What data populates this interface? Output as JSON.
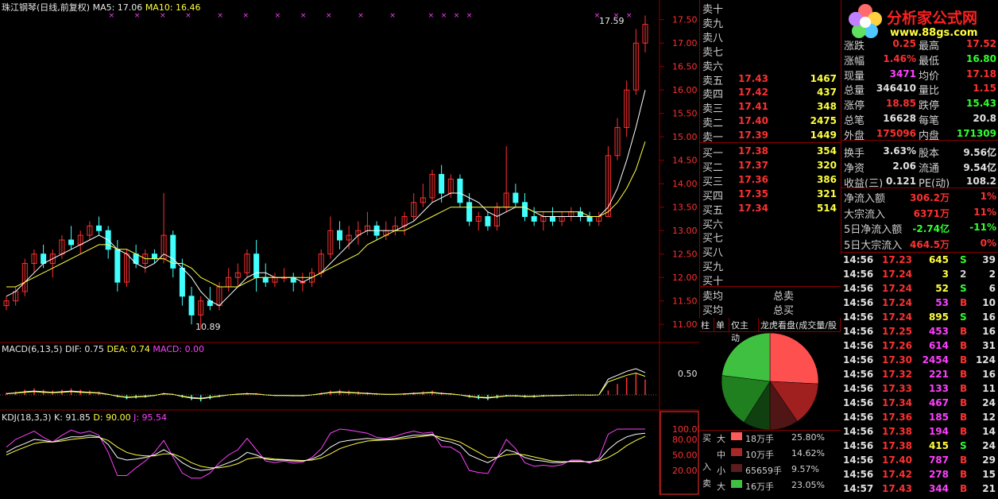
{
  "colors": {
    "up": "#ff3030",
    "down": "#40ffff",
    "ma5": "#ffffff",
    "ma10": "#ffff40",
    "magenta": "#ff40ff",
    "grid": "#8b0000",
    "bg": "#000000"
  },
  "header": {
    "stock": "珠江钢琴(日线,前复权)",
    "ma5_label": "MA5: 17.06",
    "ma10_label": "MA10: 16.46"
  },
  "main_axis": {
    "ticks": [
      "17.50",
      "17.00",
      "16.50",
      "16.00",
      "15.50",
      "15.00",
      "14.50",
      "14.00",
      "13.50",
      "13.00",
      "12.50",
      "12.00",
      "11.50",
      "11.00"
    ]
  },
  "annotations": {
    "high": "17.59",
    "low": "10.89"
  },
  "macd": {
    "label": "MACD(6,13,5)",
    "dif": "DIF: 0.75",
    "dea": "DEA: 0.74",
    "macd": "MACD: 0.00",
    "tick": "0.50"
  },
  "kdj": {
    "label": "KDJ(18,3,3)",
    "k": "K: 91.85",
    "d": "D: 90.00",
    "j": "J: 95.54",
    "ticks": [
      "100.00",
      "80.00",
      "50.00",
      "20.00"
    ]
  },
  "logo": {
    "title": "分析家公式网",
    "url": "www.88gs.com"
  },
  "order_book": {
    "sells": [
      {
        "label": "卖十",
        "price": "",
        "vol": ""
      },
      {
        "label": "卖九",
        "price": "",
        "vol": ""
      },
      {
        "label": "卖八",
        "price": "",
        "vol": ""
      },
      {
        "label": "卖七",
        "price": "",
        "vol": ""
      },
      {
        "label": "卖六",
        "price": "",
        "vol": ""
      },
      {
        "label": "卖五",
        "price": "17.43",
        "vol": "1467"
      },
      {
        "label": "卖四",
        "price": "17.42",
        "vol": "437"
      },
      {
        "label": "卖三",
        "price": "17.41",
        "vol": "348"
      },
      {
        "label": "卖二",
        "price": "17.40",
        "vol": "2475"
      },
      {
        "label": "卖一",
        "price": "17.39",
        "vol": "1449"
      }
    ],
    "buys": [
      {
        "label": "买一",
        "price": "17.38",
        "vol": "354"
      },
      {
        "label": "买二",
        "price": "17.37",
        "vol": "320"
      },
      {
        "label": "买三",
        "price": "17.36",
        "vol": "386"
      },
      {
        "label": "买四",
        "price": "17.35",
        "vol": "321"
      },
      {
        "label": "买五",
        "price": "17.34",
        "vol": "514"
      },
      {
        "label": "买六",
        "price": "",
        "vol": ""
      },
      {
        "label": "买七",
        "price": "",
        "vol": ""
      },
      {
        "label": "买八",
        "price": "",
        "vol": ""
      },
      {
        "label": "买九",
        "price": "",
        "vol": ""
      },
      {
        "label": "买十",
        "price": "",
        "vol": ""
      }
    ],
    "avg_sell": "卖均",
    "avg_buy": "买均",
    "total_sell": "总卖",
    "total_buy": "总买"
  },
  "tabs": [
    "柱",
    "单",
    "仅主动",
    "龙虎看盘(成交量/股"
  ],
  "quote": {
    "rows": [
      {
        "l1": "涨跌",
        "v1": "0.25",
        "l2": "最高",
        "v2": "17.52"
      },
      {
        "l1": "涨幅",
        "v1": "1.46%",
        "l2": "最低",
        "v2": "16.80"
      },
      {
        "l1": "现量",
        "v1": "3471",
        "l2": "均价",
        "v2": "17.18"
      },
      {
        "l1": "总量",
        "v1": "346410",
        "l2": "量比",
        "v2": "1.15"
      },
      {
        "l1": "涨停",
        "v1": "18.85",
        "l2": "跌停",
        "v2": "15.43"
      },
      {
        "l1": "总笔",
        "v1": "16628",
        "l2": "每笔",
        "v2": "20.8"
      },
      {
        "l1": "外盘",
        "v1": "175096",
        "l2": "内盘",
        "v2": "171309"
      }
    ],
    "rows2": [
      {
        "l1": "换手",
        "v1": "3.63%",
        "l2": "股本",
        "v2": "9.56亿"
      },
      {
        "l1": "净资",
        "v1": "2.06",
        "l2": "流通",
        "v2": "9.54亿"
      },
      {
        "l1": "收益(三)",
        "v1": "0.121",
        "l2": "PE(动)",
        "v2": "108.2"
      }
    ],
    "flows": [
      {
        "l": "净流入额",
        "v": "306.2万",
        "p": "1%"
      },
      {
        "l": "大宗流入",
        "v": "6371万",
        "p": "11%"
      },
      {
        "l": "5日净流入额",
        "v": "-2.74亿",
        "p": "-11%"
      },
      {
        "l": "5日大宗流入",
        "v": "464.5万",
        "p": "0%"
      }
    ]
  },
  "ticks": [
    {
      "t": "14:56",
      "p": "17.23",
      "v": "645",
      "s": "S",
      "n": "39"
    },
    {
      "t": "14:56",
      "p": "17.24",
      "v": "3",
      "s": "2",
      "n": "2"
    },
    {
      "t": "14:56",
      "p": "17.24",
      "v": "52",
      "s": "S",
      "n": "6"
    },
    {
      "t": "14:56",
      "p": "17.24",
      "v": "53",
      "s": "B",
      "n": "10"
    },
    {
      "t": "14:56",
      "p": "17.24",
      "v": "895",
      "s": "S",
      "n": "16"
    },
    {
      "t": "14:56",
      "p": "17.25",
      "v": "453",
      "s": "B",
      "n": "16"
    },
    {
      "t": "14:56",
      "p": "17.26",
      "v": "614",
      "s": "B",
      "n": "31"
    },
    {
      "t": "14:56",
      "p": "17.30",
      "v": "2454",
      "s": "B",
      "n": "124"
    },
    {
      "t": "14:56",
      "p": "17.32",
      "v": "221",
      "s": "B",
      "n": "16"
    },
    {
      "t": "14:56",
      "p": "17.33",
      "v": "133",
      "s": "B",
      "n": "11"
    },
    {
      "t": "14:56",
      "p": "17.34",
      "v": "467",
      "s": "B",
      "n": "24"
    },
    {
      "t": "14:56",
      "p": "17.36",
      "v": "185",
      "s": "B",
      "n": "12"
    },
    {
      "t": "14:56",
      "p": "17.38",
      "v": "194",
      "s": "B",
      "n": "14"
    },
    {
      "t": "14:56",
      "p": "17.38",
      "v": "415",
      "s": "S",
      "n": "24"
    },
    {
      "t": "14:56",
      "p": "17.40",
      "v": "787",
      "s": "B",
      "n": "29"
    },
    {
      "t": "14:56",
      "p": "17.42",
      "v": "278",
      "s": "B",
      "n": "15"
    },
    {
      "t": "14:57",
      "p": "17.43",
      "v": "344",
      "s": "B",
      "n": "21"
    }
  ],
  "flow_breakdown": {
    "buy_label": "买",
    "in_label": "入",
    "sell_label": "卖",
    "rows": [
      {
        "size": "大",
        "amount": "18万手",
        "pct": "25.80%",
        "color": "#ff5a5a"
      },
      {
        "size": "中",
        "amount": "10万手",
        "pct": "14.62%",
        "color": "#a82828"
      },
      {
        "size": "小",
        "amount": "65659手",
        "pct": "9.57%",
        "color": "#5a1c1c"
      },
      {
        "size": "大",
        "amount": "16万手",
        "pct": "23.05%",
        "color": "#40c040"
      }
    ]
  },
  "pie": [
    {
      "name": "big-buy",
      "pct": 25.8,
      "color": "#ff5050"
    },
    {
      "name": "mid-buy",
      "pct": 14.62,
      "color": "#a02020"
    },
    {
      "name": "small-buy",
      "pct": 9.57,
      "color": "#501515"
    },
    {
      "name": "small-sell",
      "pct": 9.0,
      "color": "#104010"
    },
    {
      "name": "mid-sell",
      "pct": 17.96,
      "color": "#208020"
    },
    {
      "name": "big-sell",
      "pct": 23.05,
      "color": "#40c040"
    }
  ],
  "candles": [
    [
      11.4,
      11.6,
      11.3,
      11.5
    ],
    [
      11.5,
      11.8,
      11.4,
      11.7
    ],
    [
      11.7,
      12.4,
      11.6,
      12.3
    ],
    [
      12.3,
      12.6,
      12.1,
      12.5
    ],
    [
      12.5,
      12.7,
      12.2,
      12.3
    ],
    [
      12.3,
      12.6,
      12.0,
      12.5
    ],
    [
      12.5,
      12.9,
      12.4,
      12.8
    ],
    [
      12.8,
      13.1,
      12.6,
      12.7
    ],
    [
      12.7,
      13.0,
      12.5,
      12.9
    ],
    [
      12.9,
      13.2,
      12.8,
      13.1
    ],
    [
      13.1,
      13.3,
      12.9,
      13.0
    ],
    [
      13.0,
      13.1,
      12.4,
      12.6
    ],
    [
      12.6,
      12.8,
      11.7,
      11.9
    ],
    [
      11.9,
      12.6,
      11.8,
      12.5
    ],
    [
      12.5,
      12.7,
      12.2,
      12.3
    ],
    [
      12.3,
      12.6,
      12.1,
      12.5
    ],
    [
      12.5,
      12.6,
      12.3,
      12.4
    ],
    [
      12.4,
      13.8,
      12.3,
      12.9
    ],
    [
      12.9,
      13.0,
      12.0,
      12.2
    ],
    [
      12.2,
      12.4,
      11.4,
      11.6
    ],
    [
      11.6,
      11.8,
      11.0,
      11.2
    ],
    [
      11.2,
      11.6,
      10.9,
      11.5
    ],
    [
      11.5,
      11.8,
      11.3,
      11.4
    ],
    [
      11.4,
      11.9,
      11.3,
      11.8
    ],
    [
      11.8,
      12.2,
      11.7,
      12.0
    ],
    [
      12.0,
      12.3,
      11.8,
      12.1
    ],
    [
      12.1,
      12.6,
      12.0,
      12.5
    ],
    [
      12.5,
      12.8,
      11.7,
      12.0
    ],
    [
      12.0,
      12.3,
      11.8,
      11.9
    ],
    [
      11.9,
      12.1,
      11.8,
      12.0
    ],
    [
      12.0,
      12.2,
      11.9,
      12.0
    ],
    [
      12.0,
      12.1,
      11.7,
      11.9
    ],
    [
      11.9,
      12.1,
      11.7,
      11.9
    ],
    [
      11.9,
      12.2,
      11.8,
      12.1
    ],
    [
      12.1,
      12.6,
      12.0,
      12.5
    ],
    [
      12.5,
      13.3,
      12.4,
      13.0
    ],
    [
      13.0,
      13.2,
      12.6,
      12.8
    ],
    [
      12.8,
      13.1,
      12.6,
      12.9
    ],
    [
      12.9,
      13.2,
      12.7,
      13.0
    ],
    [
      13.0,
      13.4,
      12.9,
      13.1
    ],
    [
      13.1,
      13.2,
      12.8,
      12.9
    ],
    [
      12.9,
      13.2,
      12.8,
      13.0
    ],
    [
      13.0,
      13.3,
      12.9,
      13.1
    ],
    [
      13.1,
      13.4,
      12.9,
      13.3
    ],
    [
      13.3,
      13.8,
      13.2,
      13.6
    ],
    [
      13.6,
      14.0,
      13.5,
      13.7
    ],
    [
      13.7,
      14.3,
      13.6,
      14.2
    ],
    [
      14.2,
      14.4,
      13.6,
      13.8
    ],
    [
      13.8,
      14.2,
      13.7,
      14.1
    ],
    [
      14.1,
      14.2,
      13.5,
      13.6
    ],
    [
      13.6,
      13.8,
      13.1,
      13.2
    ],
    [
      13.2,
      13.4,
      13.0,
      13.3
    ],
    [
      13.3,
      13.4,
      13.0,
      13.1
    ],
    [
      13.1,
      13.6,
      13.0,
      13.5
    ],
    [
      13.5,
      14.8,
      13.4,
      13.8
    ],
    [
      13.8,
      14.0,
      13.5,
      13.6
    ],
    [
      13.6,
      13.8,
      13.2,
      13.3
    ],
    [
      13.3,
      13.5,
      13.1,
      13.2
    ],
    [
      13.2,
      13.4,
      13.0,
      13.3
    ],
    [
      13.3,
      13.5,
      13.1,
      13.2
    ],
    [
      13.2,
      13.4,
      13.1,
      13.3
    ],
    [
      13.3,
      13.5,
      13.2,
      13.4
    ],
    [
      13.4,
      13.5,
      13.2,
      13.3
    ],
    [
      13.3,
      13.4,
      13.1,
      13.2
    ],
    [
      13.2,
      13.4,
      13.1,
      13.3
    ],
    [
      13.3,
      14.8,
      13.3,
      14.6
    ],
    [
      14.6,
      15.4,
      14.5,
      15.2
    ],
    [
      15.2,
      16.2,
      15.0,
      16.0
    ],
    [
      16.0,
      17.3,
      15.9,
      17.0
    ],
    [
      17.0,
      17.59,
      16.8,
      17.4
    ]
  ],
  "ma5": [
    11.6,
    11.7,
    11.9,
    12.1,
    12.3,
    12.4,
    12.5,
    12.6,
    12.7,
    12.8,
    12.9,
    12.8,
    12.6,
    12.5,
    12.3,
    12.2,
    12.3,
    12.5,
    12.4,
    12.2,
    12.0,
    11.7,
    11.5,
    11.4,
    11.6,
    11.8,
    12.0,
    12.1,
    12.1,
    12.0,
    12.0,
    12.0,
    11.9,
    12.0,
    12.1,
    12.3,
    12.5,
    12.7,
    12.9,
    13.0,
    13.0,
    13.0,
    13.0,
    13.1,
    13.2,
    13.4,
    13.6,
    13.7,
    13.8,
    13.8,
    13.7,
    13.6,
    13.4,
    13.3,
    13.4,
    13.5,
    13.5,
    13.4,
    13.3,
    13.3,
    13.3,
    13.3,
    13.3,
    13.3,
    13.3,
    13.5,
    13.9,
    14.5,
    15.2,
    16.0
  ],
  "ma10": [
    11.8,
    11.8,
    11.9,
    12.0,
    12.1,
    12.2,
    12.3,
    12.4,
    12.5,
    12.6,
    12.7,
    12.7,
    12.6,
    12.6,
    12.5,
    12.4,
    12.4,
    12.4,
    12.3,
    12.3,
    12.2,
    12.0,
    11.9,
    11.8,
    11.8,
    11.8,
    11.9,
    12.0,
    12.0,
    12.0,
    12.0,
    12.0,
    12.0,
    12.0,
    12.1,
    12.2,
    12.3,
    12.4,
    12.5,
    12.7,
    12.8,
    12.9,
    13.0,
    13.0,
    13.1,
    13.2,
    13.3,
    13.4,
    13.5,
    13.5,
    13.5,
    13.5,
    13.5,
    13.5,
    13.5,
    13.5,
    13.5,
    13.4,
    13.4,
    13.4,
    13.4,
    13.4,
    13.4,
    13.3,
    13.3,
    13.4,
    13.6,
    13.9,
    14.3,
    14.9
  ],
  "macd_hist": [
    0.05,
    0.08,
    0.12,
    0.15,
    0.12,
    0.1,
    0.12,
    0.15,
    0.12,
    0.1,
    0.08,
    0.02,
    -0.05,
    -0.1,
    -0.08,
    -0.06,
    -0.02,
    0.05,
    0.02,
    -0.06,
    -0.12,
    -0.15,
    -0.1,
    -0.05,
    0.0,
    0.03,
    0.05,
    0.04,
    0.0,
    -0.02,
    -0.02,
    -0.03,
    -0.03,
    0.0,
    0.05,
    0.1,
    0.12,
    0.1,
    0.08,
    0.06,
    0.04,
    0.02,
    0.02,
    0.04,
    0.06,
    0.08,
    0.1,
    0.06,
    0.04,
    0.0,
    -0.06,
    -0.1,
    -0.12,
    -0.08,
    -0.04,
    -0.04,
    -0.06,
    -0.06,
    -0.04,
    -0.03,
    -0.02,
    -0.01,
    0.0,
    -0.01,
    0.0,
    0.1,
    0.25,
    0.4,
    0.5,
    0.35
  ],
  "kdj_k": [
    55,
    65,
    72,
    80,
    78,
    75,
    80,
    85,
    85,
    88,
    85,
    70,
    45,
    40,
    42,
    45,
    50,
    60,
    50,
    35,
    25,
    20,
    22,
    28,
    35,
    42,
    55,
    50,
    42,
    40,
    40,
    38,
    38,
    42,
    50,
    65,
    75,
    78,
    80,
    82,
    80,
    80,
    82,
    85,
    88,
    88,
    90,
    78,
    75,
    68,
    50,
    42,
    35,
    45,
    60,
    55,
    45,
    40,
    38,
    35,
    35,
    38,
    38,
    36,
    40,
    60,
    75,
    85,
    90,
    92
  ],
  "kdj_d": [
    50,
    58,
    65,
    72,
    75,
    75,
    77,
    80,
    82,
    84,
    84,
    78,
    65,
    55,
    50,
    48,
    48,
    52,
    52,
    45,
    35,
    28,
    25,
    25,
    28,
    33,
    42,
    45,
    44,
    42,
    41,
    40,
    39,
    40,
    44,
    52,
    62,
    68,
    73,
    77,
    78,
    79,
    80,
    82,
    84,
    86,
    88,
    84,
    80,
    75,
    65,
    55,
    45,
    45,
    50,
    52,
    50,
    46,
    42,
    38,
    37,
    37,
    37,
    37,
    38,
    45,
    55,
    68,
    78,
    86
  ],
  "kdj_j": [
    65,
    80,
    88,
    96,
    84,
    75,
    88,
    98,
    92,
    96,
    88,
    55,
    10,
    10,
    25,
    38,
    55,
    78,
    46,
    15,
    5,
    5,
    15,
    35,
    50,
    60,
    82,
    60,
    38,
    35,
    38,
    34,
    36,
    45,
    62,
    92,
    100,
    98,
    95,
    92,
    84,
    82,
    86,
    92,
    96,
    92,
    94,
    66,
    65,
    54,
    20,
    16,
    14,
    45,
    80,
    62,
    35,
    28,
    30,
    28,
    31,
    40,
    40,
    34,
    44,
    90,
    100,
    100,
    100,
    100
  ]
}
